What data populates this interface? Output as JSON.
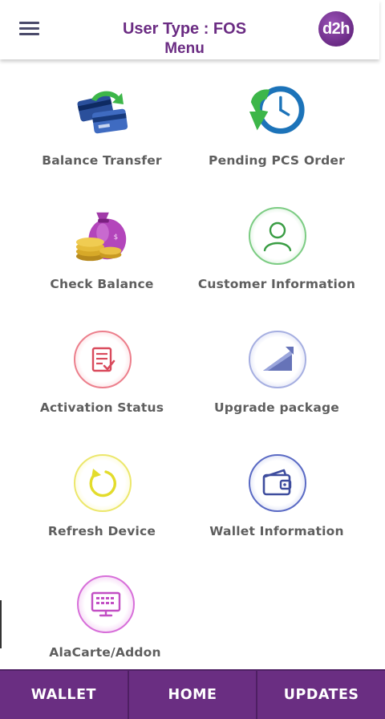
{
  "header": {
    "title": "User Type : FOS",
    "subtitle": "Menu",
    "logo_text": "d2h"
  },
  "menu_items": [
    {
      "label": "Balance Transfer",
      "icon": "card-transfer-icon"
    },
    {
      "label": "Pending PCS Order",
      "icon": "clock-arrow-icon"
    },
    {
      "label": "Check Balance",
      "icon": "money-bag-icon"
    },
    {
      "label": "Customer Information",
      "icon": "user-icon"
    },
    {
      "label": "Activation Status",
      "icon": "document-check-icon"
    },
    {
      "label": "Upgrade package",
      "icon": "upgrade-arrow-icon"
    },
    {
      "label": "Refresh Device",
      "icon": "refresh-icon"
    },
    {
      "label": "Wallet Information",
      "icon": "wallet-icon"
    },
    {
      "label": "AlaCarte/Addon",
      "icon": "keyboard-monitor-icon"
    }
  ],
  "bottom_nav": {
    "wallet": "WALLET",
    "home": "HOME",
    "updates": "UPDATES"
  },
  "colors": {
    "brand_purple": "#6a2e82",
    "title_purple": "#6b2c83",
    "label_gray": "#5e5e5e"
  }
}
